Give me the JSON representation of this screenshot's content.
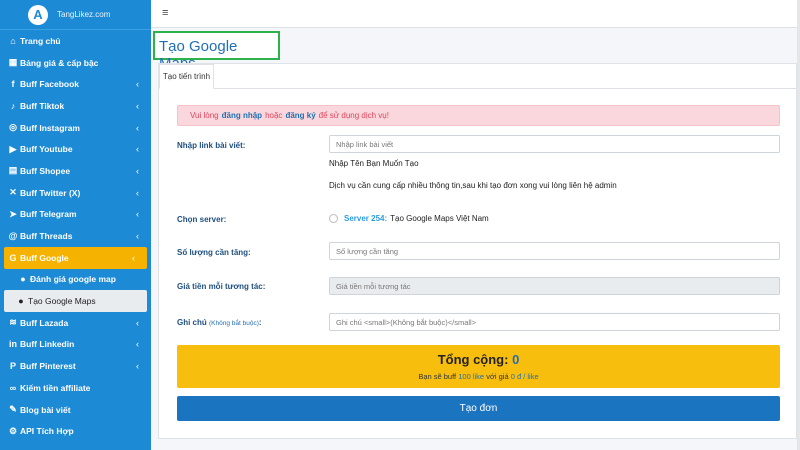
{
  "brand": {
    "logo_letter": "A",
    "name": "TangLikez.com"
  },
  "sidebar": {
    "items": [
      {
        "icon": "home-icon",
        "glyph": "⌂",
        "label": "Trang chủ",
        "chevron": false
      },
      {
        "icon": "table-icon",
        "glyph": "▦",
        "label": "Bảng giá & cấp bậc",
        "chevron": false
      },
      {
        "icon": "facebook-icon",
        "glyph": "f",
        "label": "Buff Facebook",
        "chevron": true
      },
      {
        "icon": "tiktok-icon",
        "glyph": "♪",
        "label": "Buff Tiktok",
        "chevron": true
      },
      {
        "icon": "instagram-icon",
        "glyph": "◎",
        "label": "Buff Instagram",
        "chevron": true
      },
      {
        "icon": "youtube-icon",
        "glyph": "▶",
        "label": "Buff Youtube",
        "chevron": true
      },
      {
        "icon": "shopee-icon",
        "glyph": "▤",
        "label": "Buff Shopee",
        "chevron": true
      },
      {
        "icon": "twitter-x-icon",
        "glyph": "✕",
        "label": "Buff Twitter (X)",
        "chevron": true
      },
      {
        "icon": "telegram-icon",
        "glyph": "➤",
        "label": "Buff Telegram",
        "chevron": true
      },
      {
        "icon": "threads-icon",
        "glyph": "@",
        "label": "Buff Threads",
        "chevron": true
      },
      {
        "icon": "google-icon",
        "glyph": "G",
        "label": "Buff Google",
        "chevron": true,
        "active": true
      },
      {
        "icon": "map-marker-icon",
        "glyph": "●",
        "label": "Đánh giá google map",
        "chevron": false,
        "sub": true
      },
      {
        "icon": "map-marker-icon",
        "glyph": "●",
        "label": "Tạo Google Maps",
        "chevron": false,
        "sub_active": true
      },
      {
        "icon": "lazada-icon",
        "glyph": "≋",
        "label": "Buff Lazada",
        "chevron": true
      },
      {
        "icon": "linkedin-icon",
        "glyph": "in",
        "label": "Buff Linkedin",
        "chevron": true
      },
      {
        "icon": "pinterest-icon",
        "glyph": "P",
        "label": "Buff Pinterest",
        "chevron": true
      },
      {
        "icon": "link-icon",
        "glyph": "∞",
        "label": "Kiếm tiền affiliate",
        "chevron": false
      },
      {
        "icon": "pin-icon",
        "glyph": "✎",
        "label": "Blog bài viết",
        "chevron": false
      },
      {
        "icon": "api-icon",
        "glyph": "⚙",
        "label": "API Tích Hợp",
        "chevron": false
      }
    ]
  },
  "page": {
    "title": "Tạo Google Maps"
  },
  "tabs": [
    {
      "label": "Tạo tiến trình"
    }
  ],
  "alert": {
    "pre": "Vui lòng",
    "login": "đăng nhập",
    "or": "hoặc",
    "register": "đăng ký",
    "post": "để sử dụng dịch vụ!"
  },
  "form": {
    "link_label": "Nhập link bài viết:",
    "link_placeholder": "Nhập link bài viết",
    "hint_name": "Nhập Tên Bạn Muốn Tạo",
    "hint_info": "Dịch vụ cần cung cấp nhiều thông tin,sau khi tạo đơn xong vui lòng liên hệ admin",
    "server_label": "Chọn server:",
    "server_name": "Server 254:",
    "server_desc": "Tạo Google Maps Việt Nam",
    "qty_label": "Số lượng cần tăng:",
    "qty_placeholder": "Số lượng cần tăng",
    "price_label": "Giá tiền mỗi tương tác:",
    "price_placeholder": "Giá tiền mỗi tương tác",
    "note_label": "Ghi chú",
    "note_small": "(Không bắt buộc)",
    "note_colon": ":",
    "note_placeholder": "Ghi chú <small>(Không bắt buộc)</small>"
  },
  "total": {
    "label": "Tổng cộng:",
    "value": "0",
    "sub_pre": "Bạn sẽ buff",
    "sub_qty": "100 like",
    "sub_mid": "với giá",
    "sub_price": "0 đ / like"
  },
  "submit_label": "Tạo đơn",
  "colors": {
    "sidebar": "#1d8ad6",
    "active": "#f5b300",
    "primary": "#1b74c0",
    "title_border": "#2db14b"
  }
}
